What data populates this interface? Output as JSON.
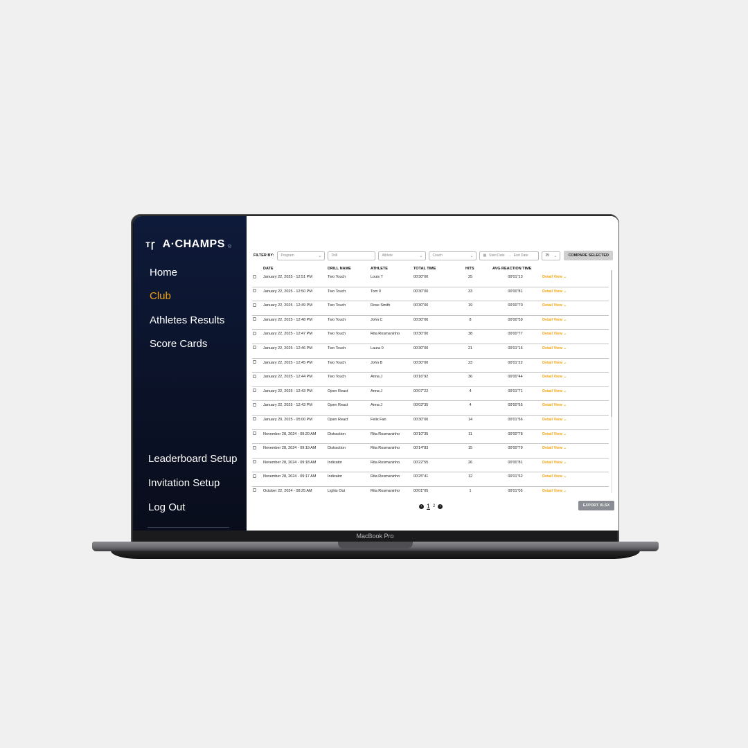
{
  "device": {
    "label": "MacBook Pro"
  },
  "brand": {
    "logo_mark": "ᴛꞅ",
    "name": "A·CHAMPS",
    "reg": "®"
  },
  "sidebar": {
    "top_items": [
      {
        "label": "Home",
        "active": false
      },
      {
        "label": "Club",
        "active": true
      },
      {
        "label": "Athletes Results",
        "active": false
      },
      {
        "label": "Score Cards",
        "active": false
      }
    ],
    "bottom_items": [
      {
        "label": "Leaderboard Setup"
      },
      {
        "label": "Invitation Setup"
      },
      {
        "label": "Log Out"
      }
    ]
  },
  "filters": {
    "label": "FILTER BY:",
    "program_placeholder": "Program",
    "drill_placeholder": "Drill",
    "athlete_placeholder": "Athlete",
    "coach_placeholder": "Coach",
    "start_date_placeholder": "Start Date",
    "date_separator": "→",
    "end_date_placeholder": "End Date",
    "page_size": "25",
    "compare_label": "COMPARE SELECTED"
  },
  "table": {
    "headers": {
      "date": "DATE",
      "drill": "DRILL NAME",
      "athlete": "ATHLETE",
      "total_time": "TOTAL TIME",
      "hits": "HITS",
      "avg": "AVG REACTION TIME"
    },
    "detail_label": "Detail View ⌄",
    "rows": [
      {
        "date": "January 22, 2025 - 12:51 PM",
        "drill": "Two Touch",
        "athlete": "Louis T",
        "total_time": "00'30\"00",
        "hits": "25",
        "avg": "00'01\"13"
      },
      {
        "date": "January 22, 2025 - 12:50 PM",
        "drill": "Two Touch",
        "athlete": "Tom 0",
        "total_time": "00'30\"00",
        "hits": "33",
        "avg": "00'00\"81"
      },
      {
        "date": "January 22, 2025 - 12:49 PM",
        "drill": "Two Touch",
        "athlete": "Rose Smith",
        "total_time": "00'30\"00",
        "hits": "19",
        "avg": "00'00\"70"
      },
      {
        "date": "January 22, 2025 - 12:48 PM",
        "drill": "Two Touch",
        "athlete": "John C",
        "total_time": "00'30\"00",
        "hits": "8",
        "avg": "00'00\"59"
      },
      {
        "date": "January 22, 2025 - 12:47 PM",
        "drill": "Two Touch",
        "athlete": "Rita Rosmaninho",
        "total_time": "00'30\"00",
        "hits": "38",
        "avg": "00'00\"77"
      },
      {
        "date": "January 22, 2025 - 12:46 PM",
        "drill": "Two Touch",
        "athlete": "Laura 0",
        "total_time": "00'30\"00",
        "hits": "21",
        "avg": "00'01\"16"
      },
      {
        "date": "January 22, 2025 - 12:45 PM",
        "drill": "Two Touch",
        "athlete": "John B",
        "total_time": "00'30\"00",
        "hits": "23",
        "avg": "00'01\"22"
      },
      {
        "date": "January 22, 2025 - 12:44 PM",
        "drill": "Two Touch",
        "athlete": "Anna J",
        "total_time": "00'16\"92",
        "hits": "36",
        "avg": "00'00\"44"
      },
      {
        "date": "January 22, 2025 - 12:43 PM",
        "drill": "Open React",
        "athlete": "Anna J",
        "total_time": "00'07\"22",
        "hits": "4",
        "avg": "00'01\"71"
      },
      {
        "date": "January 22, 2025 - 12:43 PM",
        "drill": "Open React",
        "athlete": "Anna J",
        "total_time": "00'03\"35",
        "hits": "4",
        "avg": "00'00\"65"
      },
      {
        "date": "January 20, 2025 - 05:00 PM",
        "drill": "Open React",
        "athlete": "Felix Fan",
        "total_time": "00'30\"00",
        "hits": "14",
        "avg": "00'01\"66"
      },
      {
        "date": "November 28, 2024 - 09:20 AM",
        "drill": "Distraction",
        "athlete": "Rita Rosmaninho",
        "total_time": "00'10\"35",
        "hits": "11",
        "avg": "00'00\"78"
      },
      {
        "date": "November 28, 2024 - 09:19 AM",
        "drill": "Distraction",
        "athlete": "Rita Rosmaninho",
        "total_time": "00'14\"83",
        "hits": "15",
        "avg": "00'00\"79"
      },
      {
        "date": "November 28, 2024 - 09:18 AM",
        "drill": "Indicator",
        "athlete": "Rita Rosmaninho",
        "total_time": "00'22\"55",
        "hits": "26",
        "avg": "00'00\"81"
      },
      {
        "date": "November 28, 2024 - 09:17 AM",
        "drill": "Indicator",
        "athlete": "Rita Rosmaninho",
        "total_time": "00'25\"41",
        "hits": "12",
        "avg": "00'01\"62"
      },
      {
        "date": "October 22, 2024 - 08:25 AM",
        "drill": "Lights Out",
        "athlete": "Rita Rosmaninho",
        "total_time": "00'01\"05",
        "hits": "1",
        "avg": "00'01\"05"
      }
    ]
  },
  "pagination": {
    "prev": "‹",
    "current": "1",
    "next_page": "2",
    "next": "›"
  },
  "export_label": "EXPORT XLSX",
  "colors": {
    "accent": "#f2a40e",
    "sidebar_bg": "#0b1227"
  }
}
